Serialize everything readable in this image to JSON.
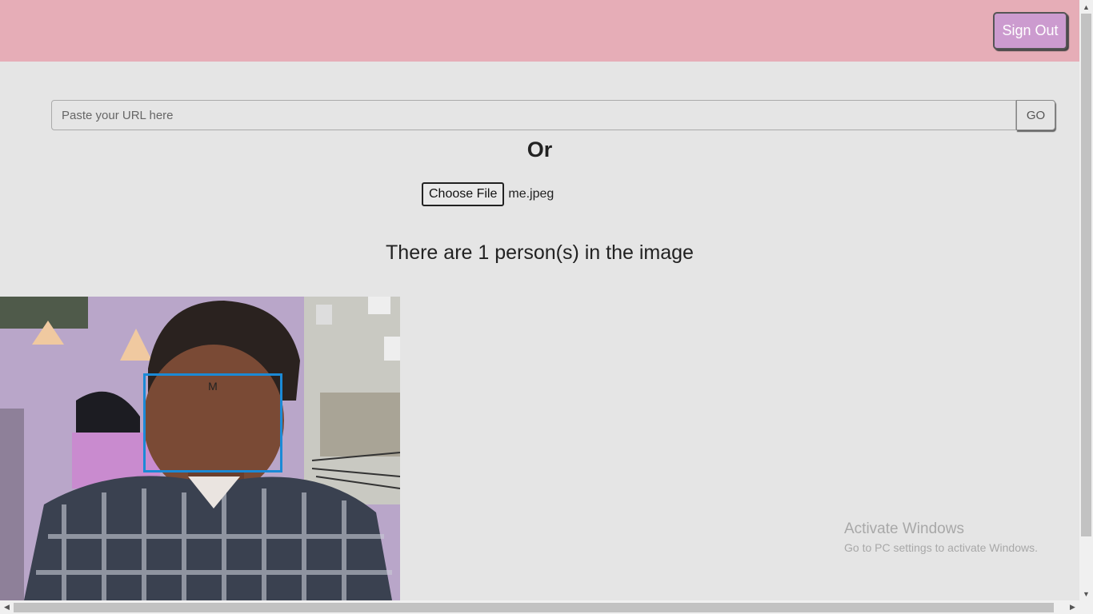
{
  "header": {
    "sign_out_label": "Sign Out"
  },
  "url_form": {
    "placeholder": "Paste your URL here",
    "value": "",
    "go_label": "GO"
  },
  "or_label": "Or",
  "file_picker": {
    "button_label": "Choose File",
    "file_name": "me.jpeg"
  },
  "result": {
    "message": "There are 1 person(s) in the image",
    "face_label": "M"
  },
  "colors": {
    "header_bg": "#e6adb7",
    "sign_out_bg": "#cc9bcf",
    "page_bg": "#e5e5e5",
    "face_box": "#1b8ad6"
  },
  "watermark": {
    "title": "Activate Windows",
    "subtitle": "Go to PC settings to activate Windows."
  },
  "icons": [
    "scroll-up-arrow-icon",
    "scroll-down-arrow-icon",
    "scroll-left-arrow-icon",
    "scroll-right-arrow-icon"
  ]
}
